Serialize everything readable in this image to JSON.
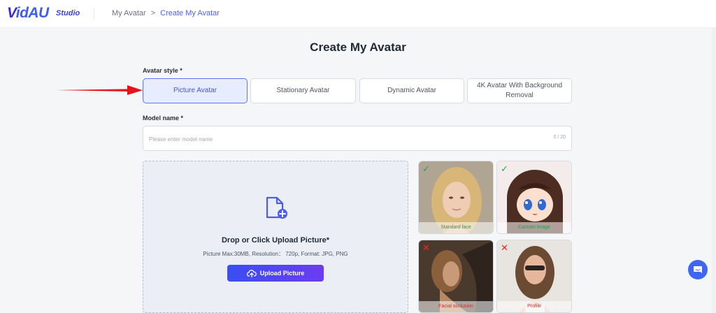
{
  "header": {
    "logo_v": "V",
    "logo_rest": "idAU",
    "logo_studio": "Studio",
    "breadcrumb": {
      "parent": "My Avatar",
      "separator": ">",
      "current": "Create My Avatar"
    }
  },
  "page": {
    "title": "Create My Avatar"
  },
  "avatar_style": {
    "label": "Avatar style *",
    "options": [
      {
        "label": "Picture Avatar",
        "selected": true
      },
      {
        "label": "Stationary Avatar",
        "selected": false
      },
      {
        "label": "Dynamic Avatar",
        "selected": false
      },
      {
        "label": "4K Avatar With Background Removal",
        "selected": false
      }
    ]
  },
  "model_name": {
    "label": "Model name *",
    "value": "",
    "placeholder": "Please enter model name",
    "counter": "0 / 20"
  },
  "upload": {
    "title": "Drop or Click Upload Picture*",
    "hint": "Picture Max:30MB, Resolution： 720p, Format: JPG, PNG",
    "button_label": "Upload Picture"
  },
  "samples": [
    {
      "caption": "Standard face",
      "status": "good",
      "mark": "✓"
    },
    {
      "caption": "Cartoon image",
      "status": "good",
      "mark": "✓"
    },
    {
      "caption": "Facial occlusion",
      "status": "bad",
      "mark": "✕"
    },
    {
      "caption": "Profile",
      "status": "bad",
      "mark": "✕"
    }
  ],
  "colors": {
    "accent": "#4f5ff5",
    "good": "#22a55a",
    "bad": "#e02c2c",
    "arrow": "#e5131b"
  },
  "icons": {
    "upload": "cloud-upload-icon",
    "file": "file-add-icon",
    "chat": "chat-icon"
  }
}
